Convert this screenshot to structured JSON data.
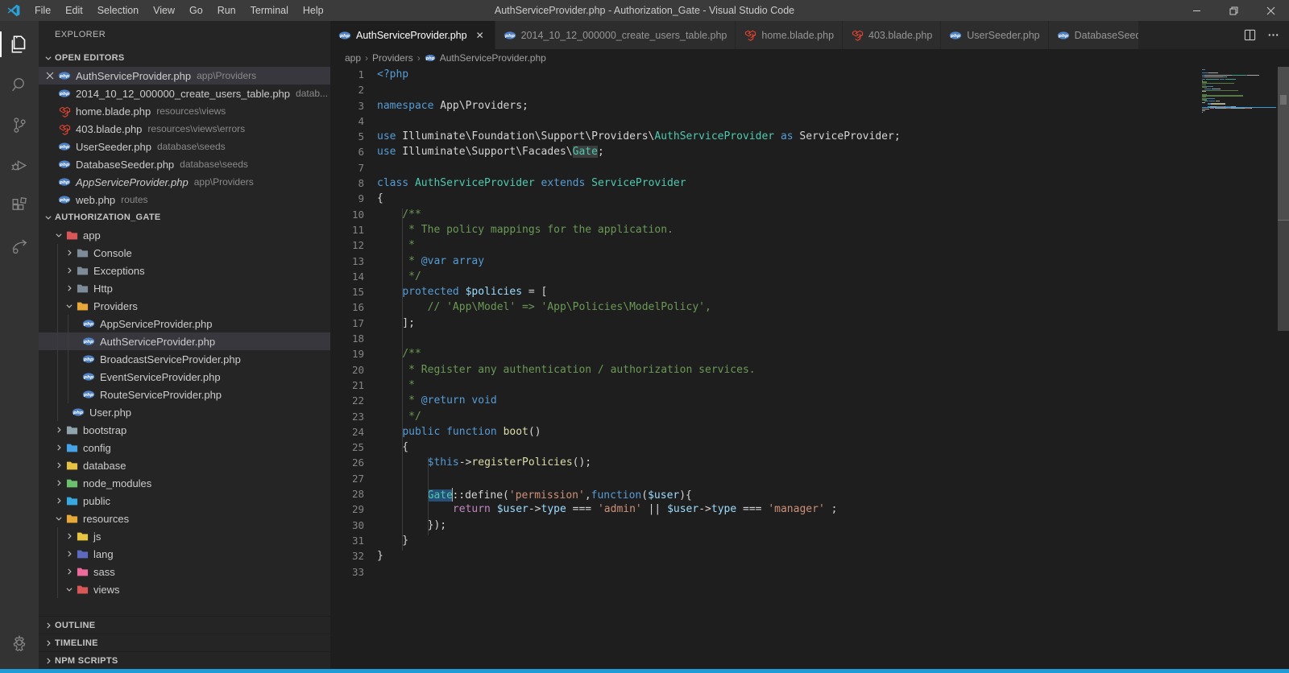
{
  "titlebar": {
    "menus": [
      "File",
      "Edit",
      "Selection",
      "View",
      "Go",
      "Run",
      "Terminal",
      "Help"
    ],
    "title": "AuthServiceProvider.php - Authorization_Gate - Visual Studio Code",
    "window_controls": [
      "minimize",
      "restore",
      "close"
    ]
  },
  "activity_bar": {
    "items": [
      {
        "name": "explorer",
        "active": true
      },
      {
        "name": "search",
        "active": false
      },
      {
        "name": "source-control",
        "active": false
      },
      {
        "name": "run-and-debug",
        "active": false
      },
      {
        "name": "extensions",
        "active": false
      },
      {
        "name": "live-share",
        "active": false
      }
    ],
    "bottom_item": "manage"
  },
  "sidebar": {
    "title": "EXPLORER",
    "open_editors_label": "OPEN EDITORS",
    "project_label": "AUTHORIZATION_GATE",
    "outline_label": "OUTLINE",
    "timeline_label": "TIMELINE",
    "npm_label": "NPM SCRIPTS",
    "open_editors": [
      {
        "file": "AuthServiceProvider.php",
        "path": "app\\Providers",
        "icon": "php",
        "active": true
      },
      {
        "file": "2014_10_12_000000_create_users_table.php",
        "path": "datab...",
        "icon": "php"
      },
      {
        "file": "home.blade.php",
        "path": "resources\\views",
        "icon": "laravel"
      },
      {
        "file": "403.blade.php",
        "path": "resources\\views\\errors",
        "icon": "laravel"
      },
      {
        "file": "UserSeeder.php",
        "path": "database\\seeds",
        "icon": "php"
      },
      {
        "file": "DatabaseSeeder.php",
        "path": "database\\seeds",
        "icon": "php"
      },
      {
        "file": "AppServiceProvider.php",
        "path": "app\\Providers",
        "icon": "php",
        "italic": true
      },
      {
        "file": "web.php",
        "path": "routes",
        "icon": "php"
      }
    ],
    "tree": [
      {
        "label": "app",
        "type": "folder",
        "state": "open",
        "level": 0,
        "color": "#d95757"
      },
      {
        "label": "Console",
        "type": "folder",
        "state": "closed",
        "level": 1,
        "color": "#7d8b99"
      },
      {
        "label": "Exceptions",
        "type": "folder",
        "state": "closed",
        "level": 1,
        "color": "#7d8b99"
      },
      {
        "label": "Http",
        "type": "folder",
        "state": "closed",
        "level": 1,
        "color": "#7d8b99"
      },
      {
        "label": "Providers",
        "type": "folder",
        "state": "open",
        "level": 1,
        "color": "#e8a838"
      },
      {
        "label": "AppServiceProvider.php",
        "type": "file",
        "icon": "php",
        "level": 2
      },
      {
        "label": "AuthServiceProvider.php",
        "type": "file",
        "icon": "php",
        "level": 2,
        "selected": true
      },
      {
        "label": "BroadcastServiceProvider.php",
        "type": "file",
        "icon": "php",
        "level": 2
      },
      {
        "label": "EventServiceProvider.php",
        "type": "file",
        "icon": "php",
        "level": 2
      },
      {
        "label": "RouteServiceProvider.php",
        "type": "file",
        "icon": "php",
        "level": 2
      },
      {
        "label": "User.php",
        "type": "file",
        "icon": "php",
        "level": 1
      },
      {
        "label": "bootstrap",
        "type": "folder",
        "state": "closed",
        "level": 0,
        "color": "#90a4ae"
      },
      {
        "label": "config",
        "type": "folder",
        "state": "closed",
        "level": 0,
        "color": "#45a3e8"
      },
      {
        "label": "database",
        "type": "folder",
        "state": "closed",
        "level": 0,
        "color": "#e8c341"
      },
      {
        "label": "node_modules",
        "type": "folder",
        "state": "closed",
        "level": 0,
        "color": "#6cbf6c"
      },
      {
        "label": "public",
        "type": "folder",
        "state": "closed",
        "level": 0,
        "color": "#38a9e0"
      },
      {
        "label": "resources",
        "type": "folder",
        "state": "open",
        "level": 0,
        "color": "#e8a838"
      },
      {
        "label": "js",
        "type": "folder",
        "state": "closed",
        "level": 1,
        "color": "#e8c341"
      },
      {
        "label": "lang",
        "type": "folder",
        "state": "closed",
        "level": 1,
        "color": "#5c6bc0"
      },
      {
        "label": "sass",
        "type": "folder",
        "state": "closed",
        "level": 1,
        "color": "#ec6a9c"
      },
      {
        "label": "views",
        "type": "folder",
        "state": "open",
        "level": 1,
        "color": "#d95757"
      }
    ]
  },
  "tabs": [
    {
      "label": "AuthServiceProvider.php",
      "icon": "php",
      "active": true,
      "close": true
    },
    {
      "label": "2014_10_12_000000_create_users_table.php",
      "icon": "php"
    },
    {
      "label": "home.blade.php",
      "icon": "laravel"
    },
    {
      "label": "403.blade.php",
      "icon": "laravel"
    },
    {
      "label": "UserSeeder.php",
      "icon": "php"
    },
    {
      "label": "DatabaseSeeder.php",
      "icon": "php"
    }
  ],
  "tab_actions": [
    "split-editor",
    "more-actions"
  ],
  "breadcrumb": {
    "items": [
      "app",
      "Providers",
      "AuthServiceProvider.php"
    ],
    "file_icon": "php"
  },
  "editor": {
    "syntax_colors": {
      "kw": "#569cd6",
      "var": "#9cdcfe",
      "fn": "#dcdcaa",
      "cls": "#4ec9b0",
      "str": "#ce9178",
      "com": "#6a9955",
      "pun": "#d4d4d4",
      "ret": "#c586c0"
    },
    "ui_colors": {
      "selection": "#264f78",
      "word_highlight": "#5a5d5e",
      "bottom_accent": "#1f9cd8",
      "minimap_selection_line": "#3e9bd8"
    },
    "lines": [
      {
        "n": 1,
        "t": [
          [
            "kw",
            "<?php"
          ]
        ]
      },
      {
        "n": 2,
        "t": []
      },
      {
        "n": 3,
        "t": [
          [
            "kw",
            "namespace"
          ],
          [
            "pun",
            " App\\Providers;"
          ]
        ]
      },
      {
        "n": 4,
        "t": []
      },
      {
        "n": 5,
        "t": [
          [
            "kw",
            "use"
          ],
          [
            "pun",
            " Illuminate\\Foundation\\Support\\Providers\\"
          ],
          [
            "cls",
            "AuthServiceProvider"
          ],
          [
            "pun",
            " "
          ],
          [
            "kw",
            "as"
          ],
          [
            "pun",
            " ServiceProvider;"
          ]
        ]
      },
      {
        "n": 6,
        "t": [
          [
            "kw",
            "use"
          ],
          [
            "pun",
            " Illuminate\\Support\\Facades\\"
          ],
          [
            "cls",
            "Gate",
            "word"
          ],
          [
            "pun",
            ";"
          ]
        ]
      },
      {
        "n": 7,
        "t": []
      },
      {
        "n": 8,
        "t": [
          [
            "kw",
            "class"
          ],
          [
            "pun",
            " "
          ],
          [
            "cls",
            "AuthServiceProvider"
          ],
          [
            "pun",
            " "
          ],
          [
            "kw",
            "extends"
          ],
          [
            "pun",
            " "
          ],
          [
            "cls",
            "ServiceProvider"
          ]
        ]
      },
      {
        "n": 9,
        "t": [
          [
            "pun",
            "{"
          ]
        ]
      },
      {
        "n": 10,
        "t": [
          [
            "com",
            "    /**"
          ]
        ]
      },
      {
        "n": 11,
        "t": [
          [
            "com",
            "     * The policy mappings for the application."
          ]
        ]
      },
      {
        "n": 12,
        "t": [
          [
            "com",
            "     *"
          ]
        ]
      },
      {
        "n": 13,
        "t": [
          [
            "com",
            "     * "
          ],
          [
            "kw",
            "@var array"
          ]
        ]
      },
      {
        "n": 14,
        "t": [
          [
            "com",
            "     */"
          ]
        ]
      },
      {
        "n": 15,
        "t": [
          [
            "pun",
            "    "
          ],
          [
            "kw",
            "protected"
          ],
          [
            "pun",
            " "
          ],
          [
            "var",
            "$policies"
          ],
          [
            "pun",
            " = ["
          ]
        ]
      },
      {
        "n": 16,
        "t": [
          [
            "com",
            "        // 'App\\Model' => 'App\\Policies\\ModelPolicy',"
          ]
        ]
      },
      {
        "n": 17,
        "t": [
          [
            "pun",
            "    ];"
          ]
        ]
      },
      {
        "n": 18,
        "t": []
      },
      {
        "n": 19,
        "t": [
          [
            "com",
            "    /**"
          ]
        ]
      },
      {
        "n": 20,
        "t": [
          [
            "com",
            "     * Register any authentication / authorization services."
          ]
        ]
      },
      {
        "n": 21,
        "t": [
          [
            "com",
            "     *"
          ]
        ]
      },
      {
        "n": 22,
        "t": [
          [
            "com",
            "     * "
          ],
          [
            "kw",
            "@return void"
          ]
        ]
      },
      {
        "n": 23,
        "t": [
          [
            "com",
            "     */"
          ]
        ]
      },
      {
        "n": 24,
        "t": [
          [
            "pun",
            "    "
          ],
          [
            "kw",
            "public"
          ],
          [
            "pun",
            " "
          ],
          [
            "kw",
            "function"
          ],
          [
            "pun",
            " "
          ],
          [
            "fn",
            "boot"
          ],
          [
            "pun",
            "()"
          ]
        ]
      },
      {
        "n": 25,
        "t": [
          [
            "pun",
            "    {"
          ]
        ]
      },
      {
        "n": 26,
        "t": [
          [
            "pun",
            "        "
          ],
          [
            "kw",
            "$this"
          ],
          [
            "pun",
            "->"
          ],
          [
            "fn",
            "registerPolicies"
          ],
          [
            "pun",
            "();"
          ]
        ]
      },
      {
        "n": 27,
        "t": []
      },
      {
        "n": 28,
        "t": [
          [
            "pun",
            "        "
          ],
          [
            "cls",
            "Gate",
            "sel"
          ],
          [
            "cursor",
            ""
          ],
          [
            "pun",
            "::define("
          ],
          [
            "str",
            "'permission'"
          ],
          [
            "pun",
            ","
          ],
          [
            "kw",
            "function"
          ],
          [
            "pun",
            "("
          ],
          [
            "var",
            "$user"
          ],
          [
            "pun",
            "){"
          ]
        ]
      },
      {
        "n": 29,
        "t": [
          [
            "pun",
            "            "
          ],
          [
            "ret",
            "return"
          ],
          [
            "pun",
            " "
          ],
          [
            "var",
            "$user"
          ],
          [
            "pun",
            "->"
          ],
          [
            "var",
            "type"
          ],
          [
            "pun",
            " === "
          ],
          [
            "str",
            "'admin'"
          ],
          [
            "pun",
            " || "
          ],
          [
            "var",
            "$user"
          ],
          [
            "pun",
            "->"
          ],
          [
            "var",
            "type"
          ],
          [
            "pun",
            " === "
          ],
          [
            "str",
            "'manager'"
          ],
          [
            "pun",
            " ;"
          ]
        ]
      },
      {
        "n": 30,
        "t": [
          [
            "pun",
            "        });"
          ]
        ]
      },
      {
        "n": 31,
        "t": [
          [
            "pun",
            "    }"
          ]
        ]
      },
      {
        "n": 32,
        "t": [
          [
            "pun",
            "}"
          ]
        ]
      },
      {
        "n": 33,
        "t": []
      }
    ]
  }
}
